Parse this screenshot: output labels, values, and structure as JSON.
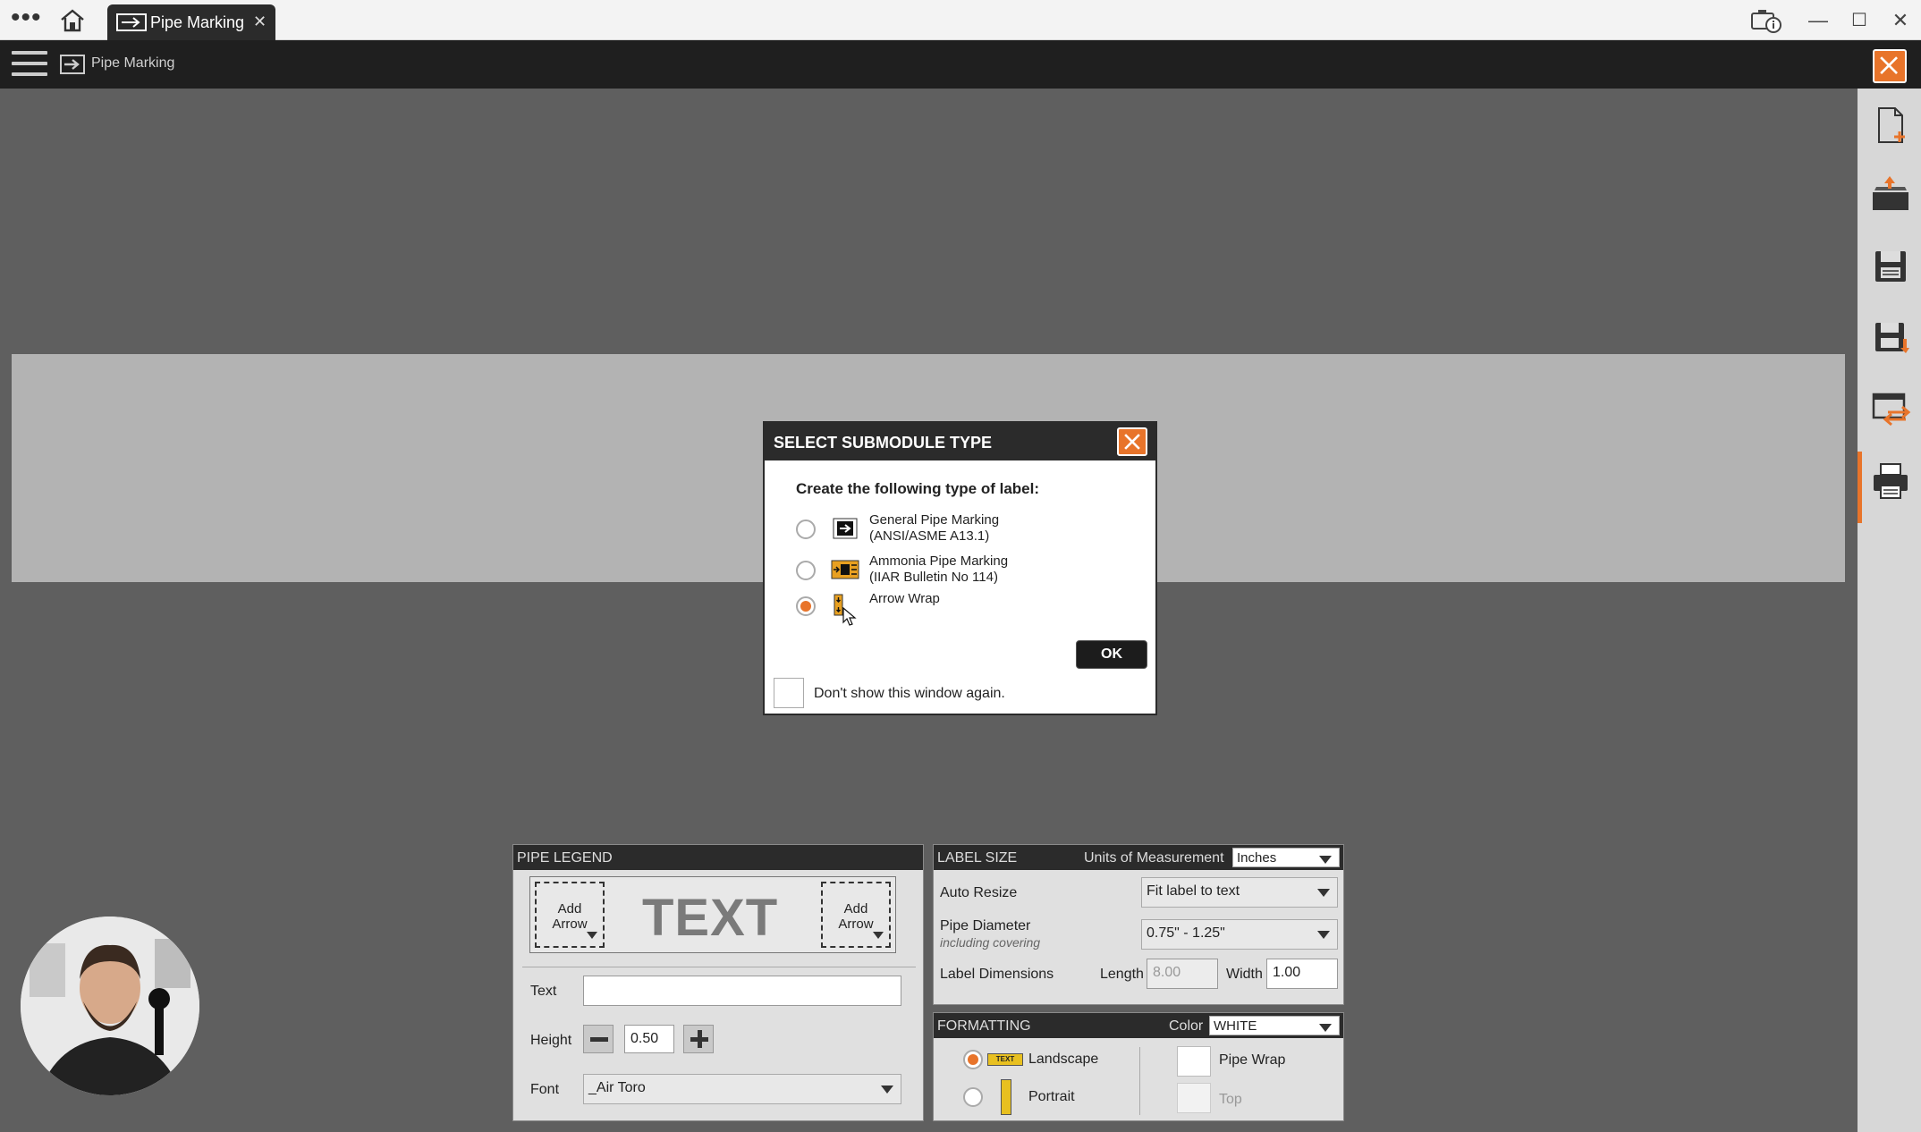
{
  "titlebar": {
    "tab_label": "Pipe Marking",
    "tab_close": "✕",
    "menu_dots": "•••",
    "minimize": "—",
    "maximize": "☐",
    "close": "✕"
  },
  "modulebar": {
    "title": "Pipe Marking"
  },
  "dialog": {
    "title": "SELECT SUBMODULE TYPE",
    "prompt": "Create the following type of label:",
    "options": [
      {
        "line1": "General Pipe Marking",
        "line2": "(ANSI/ASME A13.1)",
        "selected": false
      },
      {
        "line1": "Ammonia Pipe Marking",
        "line2": "(IIAR Bulletin No 114)",
        "selected": false
      },
      {
        "line1": "Arrow Wrap",
        "line2": "",
        "selected": true
      }
    ],
    "ok_label": "OK",
    "dont_show_label": "Don't show this window again."
  },
  "pipe_legend": {
    "header": "PIPE LEGEND",
    "add_arrow_left_1": "Add",
    "add_arrow_left_2": "Arrow",
    "add_arrow_right_1": "Add",
    "add_arrow_right_2": "Arrow",
    "preview_text": "TEXT",
    "text_label": "Text",
    "text_value": "",
    "height_label": "Height",
    "height_value": "0.50",
    "font_label": "Font",
    "font_value": "_Air Toro"
  },
  "label_size": {
    "header": "LABEL SIZE",
    "units_label": "Units of Measurement",
    "units_value": "Inches",
    "auto_resize_label": "Auto Resize",
    "auto_resize_value": "Fit label to text",
    "pipe_diameter_label": "Pipe Diameter",
    "pipe_diameter_sub": "including covering",
    "pipe_diameter_value": "0.75\" - 1.25\"",
    "dimensions_label": "Label Dimensions",
    "length_label": "Length",
    "length_value": "8.00",
    "width_label": "Width",
    "width_value": "1.00"
  },
  "formatting": {
    "header": "FORMATTING",
    "color_label": "Color",
    "color_value": "WHITE",
    "landscape_label": "Landscape",
    "landscape_icon_text": "TEXT",
    "portrait_label": "Portrait",
    "landscape_selected": true,
    "pipe_wrap_label": "Pipe Wrap",
    "top_label": "Top"
  },
  "colors": {
    "accent": "#e8742a",
    "dark_bar": "#1f1f1f",
    "panel_bg": "#e0e0e0"
  }
}
